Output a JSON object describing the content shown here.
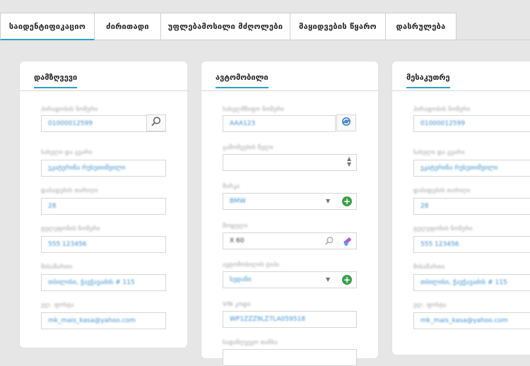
{
  "tabs": [
    {
      "label": "საიდენტიფიკაციო"
    },
    {
      "label": "ძირითადი"
    },
    {
      "label": "უფლებამოსილი მძღოლები"
    },
    {
      "label": "მაყიდვების წყარო"
    },
    {
      "label": "დასრულება"
    }
  ],
  "cards": {
    "insured": {
      "title": "დამზღვევი",
      "fields": [
        {
          "label": "პირადობის ნომერი",
          "value": "01000012599"
        },
        {
          "label": "სახელი და გვარი",
          "value": "ეკატერინა რუსეთიშვილი"
        },
        {
          "label": "დაბადების თარიღი",
          "value": "28"
        },
        {
          "label": "ტელეფონის ნომერი",
          "value": "555 123456"
        },
        {
          "label": "მისამართი",
          "value": "თბილისი, ჭავჭავაძის # 115"
        },
        {
          "label": "ელ. ფოსტა",
          "value": "mk_mais_kasa@yahoo.com"
        }
      ]
    },
    "vehicle": {
      "title": "ავტომობილი",
      "fields": [
        {
          "label": "სახელმწიფო ნომერი",
          "value": "AAA123"
        },
        {
          "label": "გამოშვების წელი",
          "value": ""
        },
        {
          "label": "მარკა",
          "value": "BMW"
        },
        {
          "label": "მოდელი",
          "value": "X 60"
        },
        {
          "label": "ავტომობილის ტიპი",
          "value": "სედანი"
        },
        {
          "label": "VIN კოდი",
          "value": "WP1ZZZ9LZ7LA059518"
        },
        {
          "label": "სადაზღვევო თანხა",
          "value": ""
        }
      ]
    },
    "owner": {
      "title": "მესაკუთრე",
      "fields": [
        {
          "label": "პირადობის ნომერი",
          "value": "01000012599"
        },
        {
          "label": "სახელი და გვარი",
          "value": "ეკატერინა რუსეთიშვილი"
        },
        {
          "label": "დაბადების თარიღი",
          "value": "28"
        },
        {
          "label": "ტელეფონის ნომერი",
          "value": "555 123456"
        },
        {
          "label": "მისამართი",
          "value": "თბილისი, ჭავჭავაძის # 115"
        },
        {
          "label": "ელ. ფოსტა",
          "value": "mk_mais_kasa@yahoo.com"
        }
      ]
    }
  },
  "icons": {
    "search": "search-icon",
    "refresh": "refresh-icon",
    "add": "add-icon",
    "clear": "eraser-icon",
    "dropdown": "chevron-down-icon",
    "stepper": "stepper-icon"
  },
  "colors": {
    "accent": "#2aa0c9",
    "value_text": "#3a8fd0",
    "add": "#3aa04b",
    "background": "#e6e6e6"
  }
}
